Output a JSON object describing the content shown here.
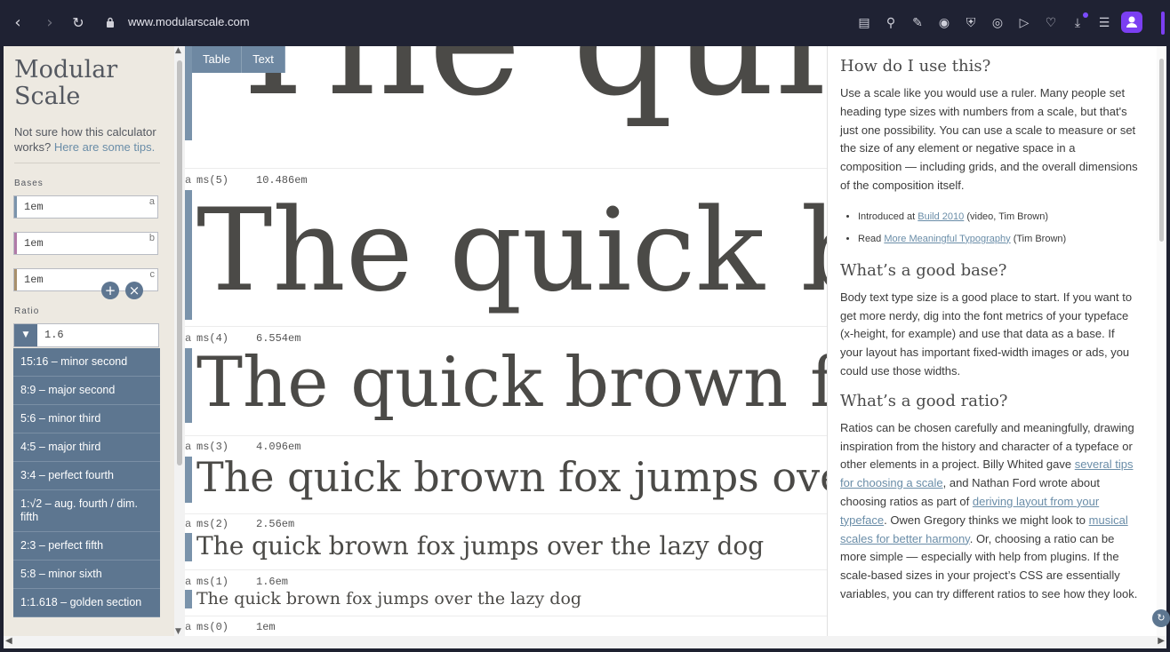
{
  "browser": {
    "url": "www.modularscale.com"
  },
  "sidebar": {
    "logo_line1": "Modular",
    "logo_line2": "Scale",
    "tip_text": "Not sure how this calculator works?",
    "tip_link": "Here are some tips.",
    "bases_label": "Bases",
    "bases": [
      {
        "value": "1em",
        "key": "a",
        "color": "#7a93ab"
      },
      {
        "value": "1em",
        "key": "b",
        "color": "#b07aa8"
      },
      {
        "value": "1em",
        "key": "c",
        "color": "#a88f6b"
      }
    ],
    "ratio_label": "Ratio",
    "ratio_value": "1.6",
    "ratio_options": [
      "15:16 – minor second",
      "8:9 – major second",
      "5:6 – minor third",
      "4:5 – major third",
      "3:4 – perfect fourth",
      "1:√2 – aug. fourth / dim. fifth",
      "2:3 – perfect fifth",
      "5:8 – minor sixth",
      "1:1.618 – golden section"
    ]
  },
  "center": {
    "tabs": [
      "Table",
      "Text"
    ],
    "top_fragment": "The quic",
    "sample_text": "The quick brown fox jumps over the lazy dog",
    "rows": [
      {
        "a": "a",
        "label": "ms(5)",
        "em": "10.486em",
        "sample": "The quick bro"
      },
      {
        "a": "a",
        "label": "ms(4)",
        "em": "6.554em",
        "sample": "The quick brown fox"
      },
      {
        "a": "a",
        "label": "ms(3)",
        "em": "4.096em",
        "sample": "The quick brown fox jumps over"
      },
      {
        "a": "a",
        "label": "ms(2)",
        "em": "2.56em",
        "sample": "The quick brown fox jumps over the lazy dog"
      },
      {
        "a": "a",
        "label": "ms(1)",
        "em": "1.6em",
        "sample": "The quick brown fox jumps over the lazy dog"
      },
      {
        "a": "a",
        "label": "ms(0)",
        "em": "1em",
        "sample": ""
      }
    ]
  },
  "help": {
    "h1": "How do I use this?",
    "p1": "Use a scale like you would use a ruler. Many people set heading type sizes with numbers from a scale, but that's just one possibility. You can use a scale to measure or set the size of any element or negative space in a composition — including grids, and the overall dimensions of the composition itself.",
    "li1_pre": "Introduced at ",
    "li1_link": "Build 2010",
    "li1_post": " (video, Tim Brown)",
    "li2_pre": "Read ",
    "li2_link": "More Meaningful Typography",
    "li2_post": " (Tim Brown)",
    "h2": "What’s a good base?",
    "p2": "Body text type size is a good place to start. If you want to get more nerdy, dig into the font metrics of your typeface (x-height, for example) and use that data as a base. If your layout has important fixed-width images or ads, you could use those widths.",
    "h3": "What’s a good ratio?",
    "p3_a": "Ratios can be chosen carefully and meaningfully, drawing inspiration from the history and character of a typeface or other elements in a project. Billy Whited gave ",
    "p3_link1": "several tips for choosing a scale",
    "p3_b": ", and Nathan Ford wrote about choosing ratios as part of ",
    "p3_link2": "deriving layout from your typeface",
    "p3_c": ". Owen Gregory thinks we might look to ",
    "p3_link3": "musical scales for better harmony",
    "p3_d": ". Or, choosing a ratio can be more simple — especially with help from plugins. If the scale-based sizes in your project’s CSS are essentially variables, you can try different ratios to see how they look."
  }
}
